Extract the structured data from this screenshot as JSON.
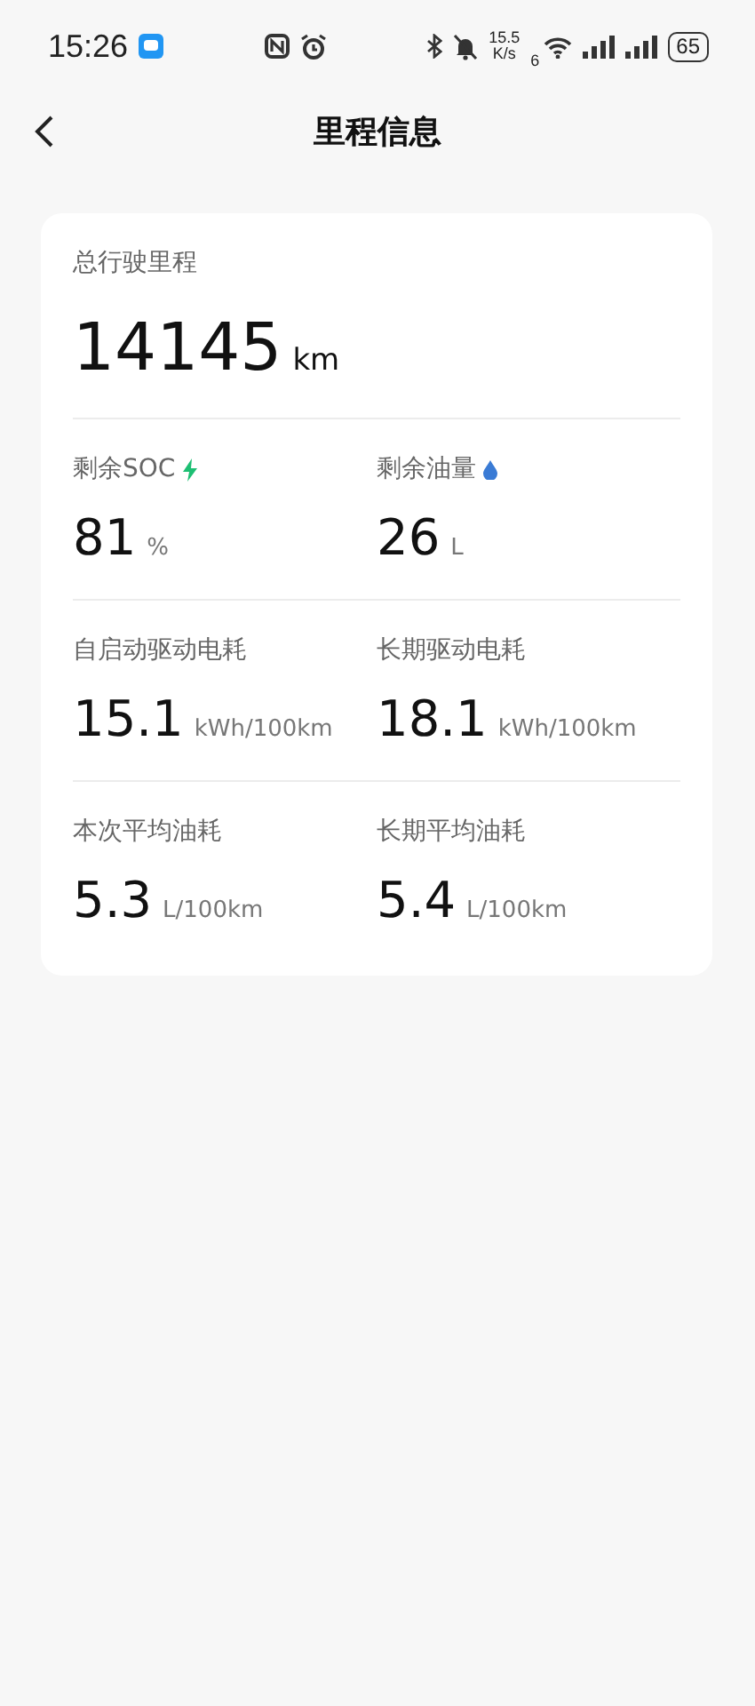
{
  "status_bar": {
    "time": "15:26",
    "net_speed": "15.5",
    "net_unit": "K/s",
    "wifi_badge": "6",
    "battery": "65"
  },
  "header": {
    "title": "里程信息"
  },
  "total": {
    "label": "总行驶里程",
    "value": "14145",
    "unit": "km"
  },
  "rows": [
    [
      {
        "label": "剩余SOC",
        "kind": "charge",
        "value": "81",
        "unit": "%"
      },
      {
        "label": "剩余油量",
        "kind": "fuel",
        "value": "26",
        "unit": "L"
      }
    ],
    [
      {
        "label": "自启动驱动电耗",
        "value": "15.1",
        "unit": "kWh/100km"
      },
      {
        "label": "长期驱动电耗",
        "value": "18.1",
        "unit": "kWh/100km"
      }
    ],
    [
      {
        "label": "本次平均油耗",
        "value": "5.3",
        "unit": "L/100km"
      },
      {
        "label": "长期平均油耗",
        "value": "5.4",
        "unit": "L/100km"
      }
    ]
  ]
}
